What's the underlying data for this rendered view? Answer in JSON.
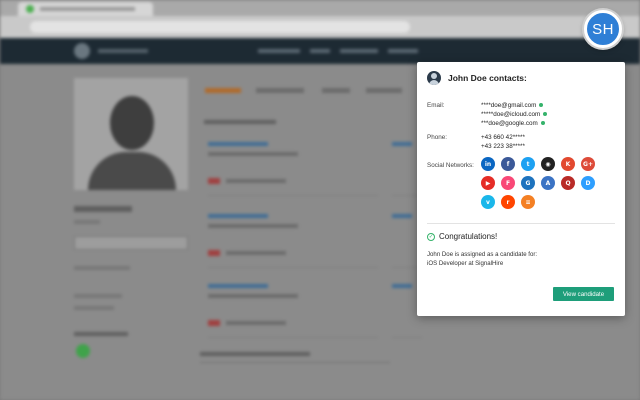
{
  "extension": {
    "badge_text": "SH",
    "badge_color": "#2f7fd6"
  },
  "popup": {
    "title": "John Doe contacts:",
    "email_label": "Email:",
    "emails": [
      "****doe@gmail.com",
      "*****doe@icloud.com",
      "***doe@google.com"
    ],
    "phone_label": "Phone:",
    "phones": [
      "+43 660 42*****",
      "+43 223 38*****"
    ],
    "social_label": "Social Networks:",
    "socials": [
      {
        "name": "linkedin",
        "glyph": "in",
        "color": "#0a66c2"
      },
      {
        "name": "facebook",
        "glyph": "f",
        "color": "#3b5998"
      },
      {
        "name": "twitter",
        "glyph": "t",
        "color": "#1da1f2"
      },
      {
        "name": "github",
        "glyph": "◉",
        "color": "#222222"
      },
      {
        "name": "klout",
        "glyph": "K",
        "color": "#e2492f"
      },
      {
        "name": "google-plus",
        "glyph": "G+",
        "color": "#dd4b39"
      },
      {
        "name": "youtube",
        "glyph": "▶",
        "color": "#e52d27"
      },
      {
        "name": "foursquare",
        "glyph": "F",
        "color": "#f94877"
      },
      {
        "name": "gravatar",
        "glyph": "G",
        "color": "#1e73be"
      },
      {
        "name": "angellist",
        "glyph": "A",
        "color": "#3b73c4"
      },
      {
        "name": "quora",
        "glyph": "Q",
        "color": "#b92b27"
      },
      {
        "name": "disqus",
        "glyph": "D",
        "color": "#2e9fff"
      },
      {
        "name": "vimeo",
        "glyph": "v",
        "color": "#1ab7ea"
      },
      {
        "name": "reddit",
        "glyph": "r",
        "color": "#ff4500"
      },
      {
        "name": "stackoverflow",
        "glyph": "≡",
        "color": "#f48024"
      }
    ],
    "congrats_title": "Congratulations!",
    "message_line1": "John Doe is assigned as a candidate for:",
    "message_line2": "iOS Developer at SignalHire",
    "button_label": "View candidate",
    "accent_color": "#1e9e7a"
  }
}
